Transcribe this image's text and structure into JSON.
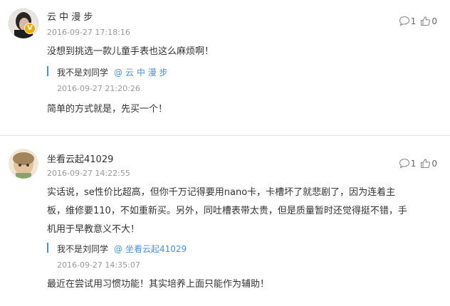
{
  "comments": [
    {
      "username": "云 中 漫 步",
      "timestamp": "2016-09-27 17:18:16",
      "reply_count": "1",
      "like_count": "0",
      "text": "没想到挑选一款儿童手表也这么麻烦啊！",
      "verified_badge": "V",
      "reply": {
        "author": "我不是刘同学",
        "at_symbol": "@",
        "target": "云 中 漫 步",
        "timestamp": "2016-09-27 21:20:26",
        "text": "简单的方式就是，先买一个！"
      }
    },
    {
      "username": "坐看云起41029",
      "timestamp": "2016-09-27 14:22:55",
      "reply_count": "1",
      "like_count": "0",
      "text_lines": [
        "实话说，se性价比超高，但你千万记得要用nano卡，卡槽坏了就悲剧了，因为连着主",
        "板，维修要110，不如重新买。另外，同吐槽表带太贵，但是质量暂时还觉得挺不错，手",
        "机用于早教意义不大！"
      ],
      "reply": {
        "author": "我不是刘同学",
        "at_symbol": "@",
        "target": "坐看云起41029",
        "timestamp": "2016-09-27 14:35:07",
        "text": "最近在尝试用习惯功能！其实培养上面只能作为辅助！"
      }
    }
  ],
  "icons": {
    "reply": "comment-bubble-icon",
    "like": "thumbs-up-icon"
  },
  "colors": {
    "accent": "#4a90d9",
    "badge": "#f2a900",
    "muted": "#999999"
  }
}
